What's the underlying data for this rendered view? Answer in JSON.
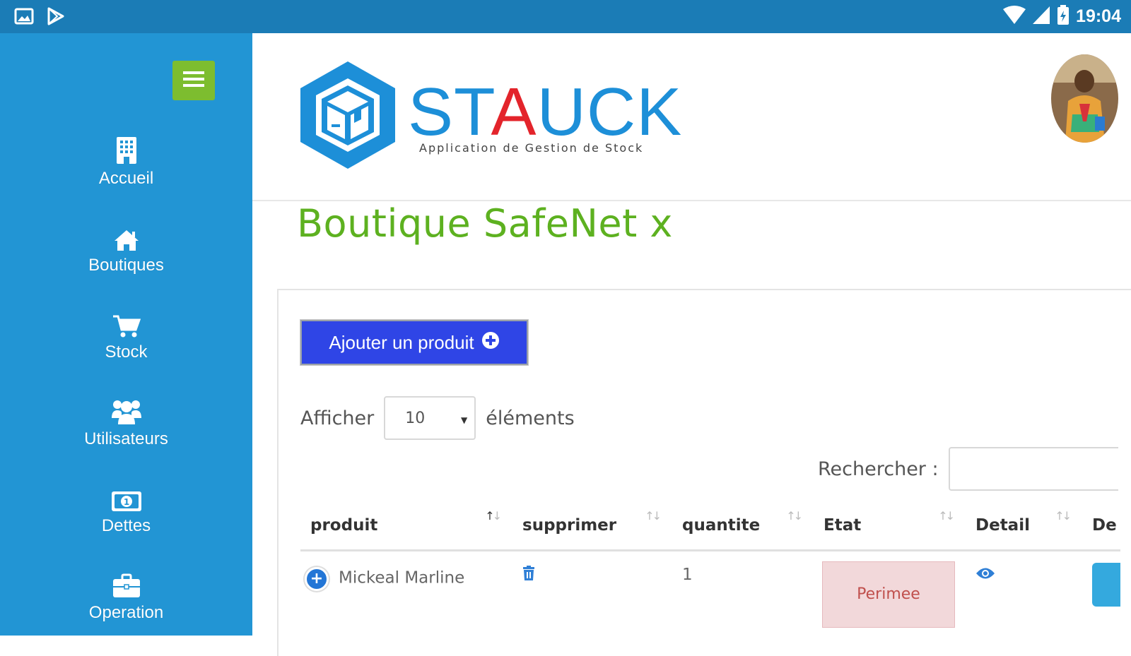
{
  "statusbar": {
    "time": "19:04"
  },
  "sidebar": {
    "items": [
      {
        "label": "Accueil",
        "icon": "building-icon"
      },
      {
        "label": "Boutiques",
        "icon": "home-icon"
      },
      {
        "label": "Stock",
        "icon": "cart-icon"
      },
      {
        "label": "Utilisateurs",
        "icon": "users-icon"
      },
      {
        "label": "Dettes",
        "icon": "money-icon"
      },
      {
        "label": "Operation",
        "icon": "briefcase-icon"
      }
    ]
  },
  "brand": {
    "name_part1": "ST",
    "name_part2": "A",
    "name_part3": "UCK",
    "tagline": "Application de Gestion de Stock",
    "color_blue": "#1d8fd8",
    "color_red": "#e3242b"
  },
  "page": {
    "title": "Boutique SafeNet x"
  },
  "toolbar": {
    "add_label": "Ajouter un produit"
  },
  "length": {
    "before": "Afficher",
    "value": "10",
    "after": "éléments"
  },
  "search": {
    "label": "Rechercher :",
    "value": ""
  },
  "table": {
    "headers": [
      "produit",
      "supprimer",
      "quantite",
      "Etat",
      "Detail",
      "De"
    ],
    "rows": [
      {
        "produit": "Mickeal Marline",
        "quantite": "1",
        "etat": "Perimee"
      }
    ]
  },
  "colors": {
    "sidebar": "#2295d4",
    "statusbar": "#1b7cb6",
    "accent_green": "#5db120",
    "button_blue": "#2f45e6"
  }
}
